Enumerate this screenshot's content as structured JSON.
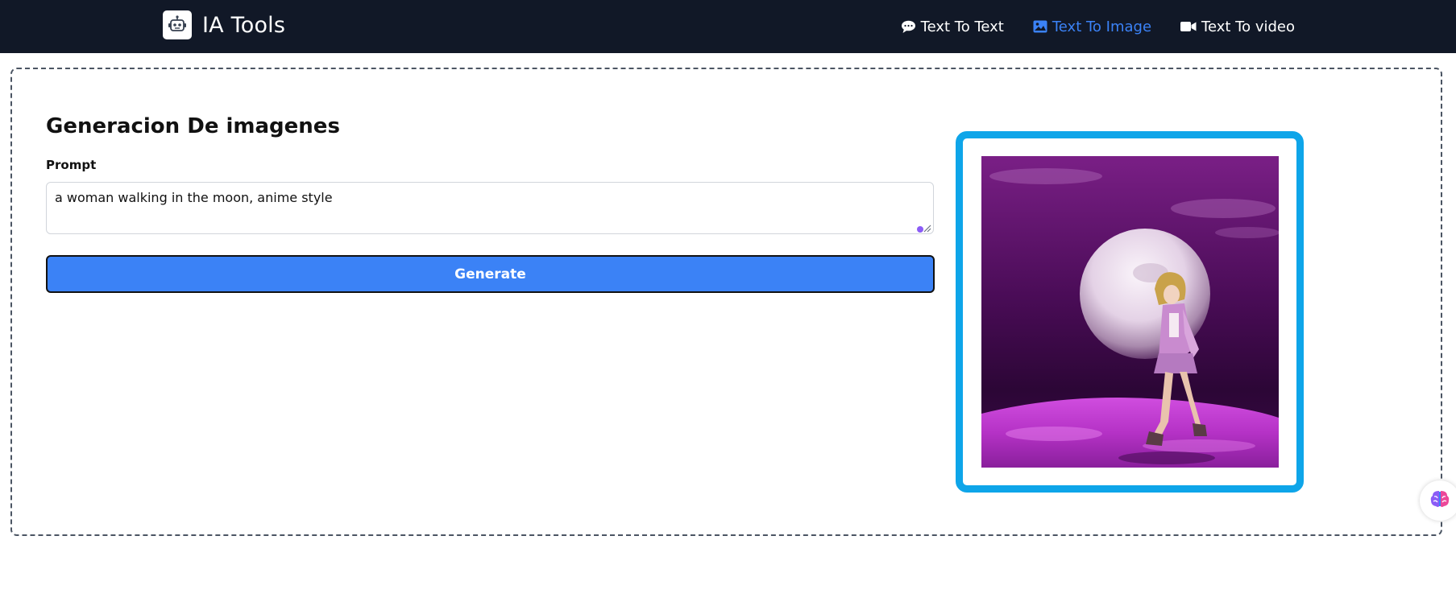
{
  "navbar": {
    "brand_title": "IA Tools",
    "brand_icon": "robot-icon",
    "links": [
      {
        "label": "Text To Text",
        "icon": "comment-icon",
        "active": false
      },
      {
        "label": "Text To Image",
        "icon": "image-icon",
        "active": true
      },
      {
        "label": "Text To video",
        "icon": "video-icon",
        "active": false
      }
    ]
  },
  "main": {
    "title": "Generacion De imagenes",
    "prompt_label": "Prompt",
    "prompt_value": "a woman walking in the moon, anime style",
    "generate_label": "Generate"
  },
  "colors": {
    "navbar_bg": "#111827",
    "active_link": "#3b82f6",
    "button_bg": "#3b82f6",
    "image_frame": "#0ea5e9"
  },
  "floating_button_icon": "brain-icon"
}
